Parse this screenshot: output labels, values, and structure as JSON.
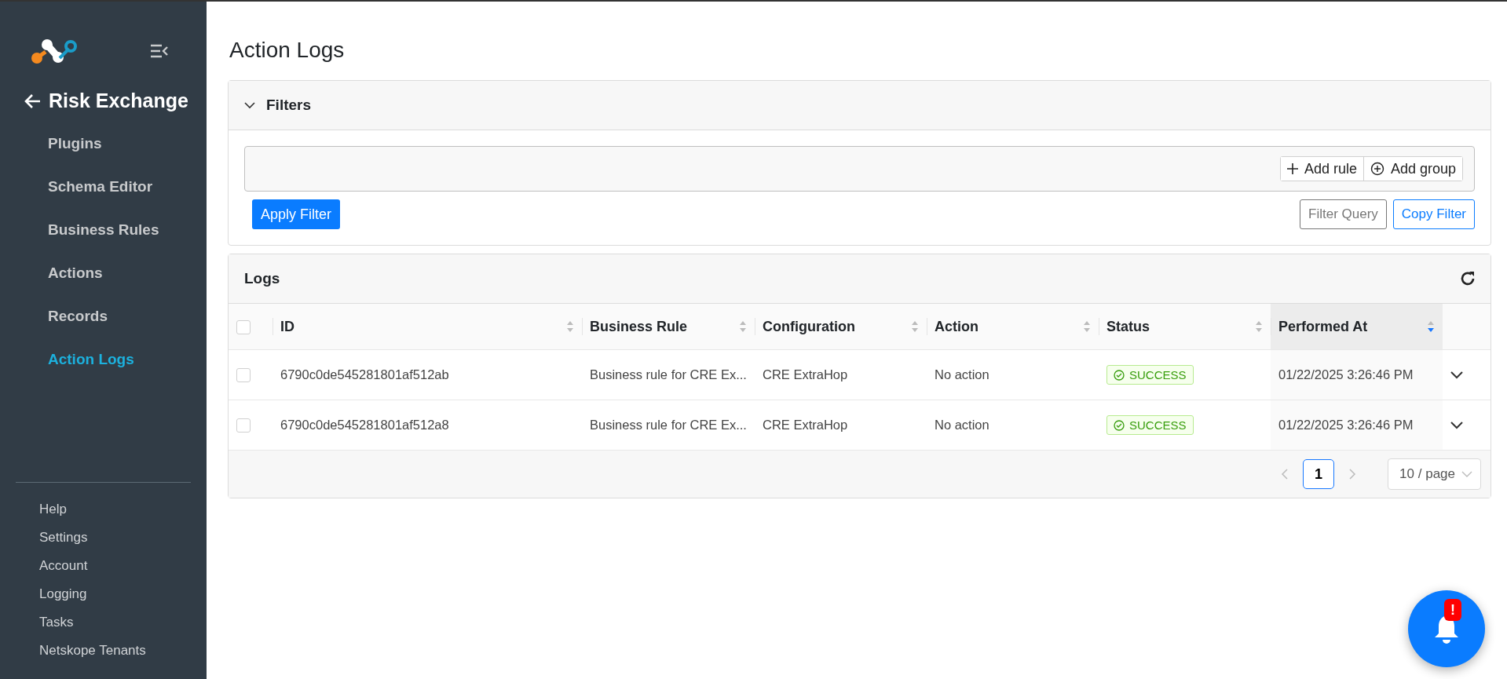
{
  "sidebar": {
    "section_title": "Risk Exchange",
    "items": [
      {
        "label": "Plugins",
        "selected": false
      },
      {
        "label": "Schema Editor",
        "selected": false
      },
      {
        "label": "Business Rules",
        "selected": false
      },
      {
        "label": "Actions",
        "selected": false
      },
      {
        "label": "Records",
        "selected": false
      },
      {
        "label": "Action Logs",
        "selected": true
      }
    ],
    "footer_items": [
      "Help",
      "Settings",
      "Account",
      "Logging",
      "Tasks",
      "Netskope Tenants"
    ]
  },
  "page_title": "Action Logs",
  "filters": {
    "title": "Filters",
    "expanded": true,
    "add_rule": "Add rule",
    "add_group": "Add group",
    "apply": "Apply Filter",
    "filter_query": "Filter Query",
    "copy_filter": "Copy Filter"
  },
  "logs": {
    "title": "Logs",
    "all_checked": false,
    "columns": [
      {
        "label": "ID",
        "sorted": false
      },
      {
        "label": "Business Rule",
        "sorted": false
      },
      {
        "label": "Configuration",
        "sorted": false
      },
      {
        "label": "Action",
        "sorted": false
      },
      {
        "label": "Status",
        "sorted": false
      },
      {
        "label": "Performed At",
        "sorted": true
      }
    ],
    "rows": [
      {
        "checked": false,
        "id": "6790c0de545281801af512ab",
        "business_rule": "Business rule for CRE Ex...",
        "configuration": "CRE ExtraHop",
        "action": "No action",
        "status": "SUCCESS",
        "performed_at": "01/22/2025 3:26:46 PM",
        "expanded": false
      },
      {
        "checked": false,
        "id": "6790c0de545281801af512a8",
        "business_rule": "Business rule for CRE Ex...",
        "configuration": "CRE ExtraHop",
        "action": "No action",
        "status": "SUCCESS",
        "performed_at": "01/22/2025 3:26:46 PM",
        "expanded": false
      }
    ],
    "pagination": {
      "pages": [
        {
          "label": "1",
          "selected": true
        }
      ],
      "page_size": "10 / page"
    }
  },
  "notifications": {
    "badge": "!"
  }
}
